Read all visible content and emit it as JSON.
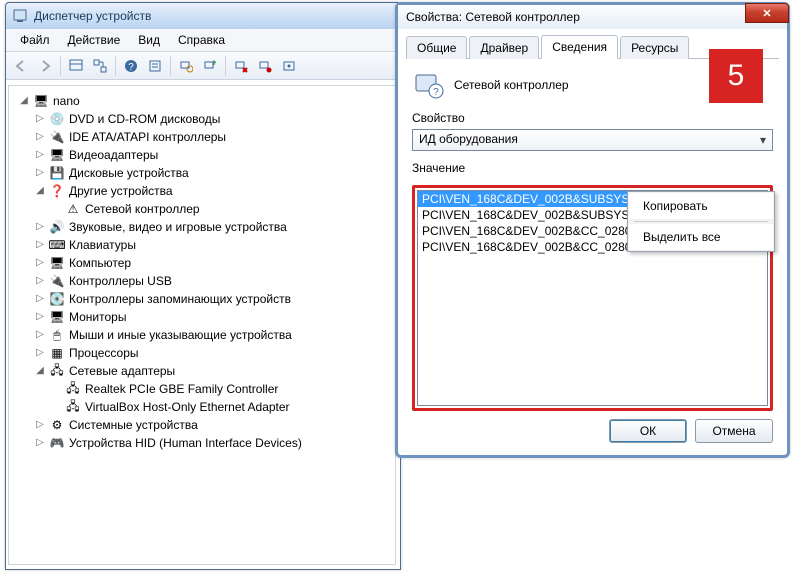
{
  "step_badge": "5",
  "main": {
    "title": "Диспетчер устройств",
    "menu": [
      "Файл",
      "Действие",
      "Вид",
      "Справка"
    ],
    "tree": {
      "root": "nano",
      "nodes": [
        {
          "label": "DVD и CD-ROM дисководы",
          "icon": "disc"
        },
        {
          "label": "IDE ATA/ATAPI контроллеры",
          "icon": "ide"
        },
        {
          "label": "Видеоадаптеры",
          "icon": "video"
        },
        {
          "label": "Дисковые устройства",
          "icon": "disk"
        },
        {
          "label": "Другие устройства",
          "icon": "other",
          "expanded": true,
          "children": [
            {
              "label": "Сетевой контроллер",
              "icon": "unknown"
            }
          ]
        },
        {
          "label": "Звуковые, видео и игровые устройства",
          "icon": "sound"
        },
        {
          "label": "Клавиатуры",
          "icon": "keyboard"
        },
        {
          "label": "Компьютер",
          "icon": "computer"
        },
        {
          "label": "Контроллеры USB",
          "icon": "usb"
        },
        {
          "label": "Контроллеры запоминающих устройств",
          "icon": "storage"
        },
        {
          "label": "Мониторы",
          "icon": "monitor"
        },
        {
          "label": "Мыши и иные указывающие устройства",
          "icon": "mouse"
        },
        {
          "label": "Процессоры",
          "icon": "cpu"
        },
        {
          "label": "Сетевые адаптеры",
          "icon": "net",
          "expanded": true,
          "children": [
            {
              "label": "Realtek PCIe GBE Family Controller",
              "icon": "nic"
            },
            {
              "label": "VirtualBox Host-Only Ethernet Adapter",
              "icon": "nic"
            }
          ]
        },
        {
          "label": "Системные устройства",
          "icon": "system"
        },
        {
          "label": "Устройства HID (Human Interface Devices)",
          "icon": "hid"
        }
      ]
    }
  },
  "dialog": {
    "title": "Свойства: Сетевой контроллер",
    "tabs": [
      "Общие",
      "Драйвер",
      "Сведения",
      "Ресурсы"
    ],
    "active_tab": "Сведения",
    "device_name": "Сетевой контроллер",
    "property_label": "Свойство",
    "property_value": "ИД оборудования",
    "value_label": "Значение",
    "values": [
      "PCI\\VEN_168C&DEV_002B&SUBSYS_108",
      "PCI\\VEN_168C&DEV_002B&SUBSYS_108",
      "PCI\\VEN_168C&DEV_002B&CC_028000",
      "PCI\\VEN_168C&DEV_002B&CC_0280"
    ],
    "selected_index": 0,
    "buttons": {
      "ok": "ОК",
      "cancel": "Отмена"
    }
  },
  "context_menu": {
    "items": [
      "Копировать",
      "Выделить все"
    ]
  }
}
